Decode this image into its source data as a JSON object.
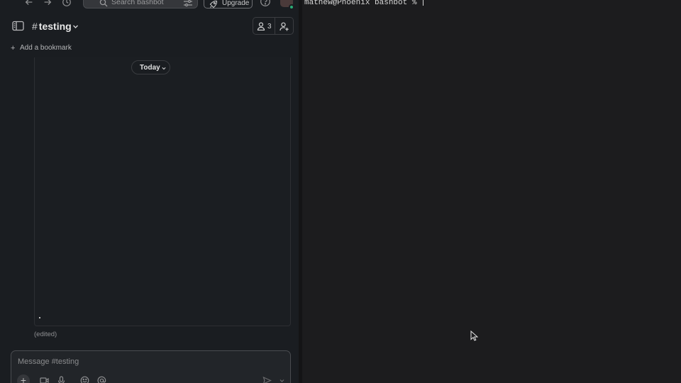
{
  "slack": {
    "search_placeholder": "Search bashbot",
    "upgrade_label": "Upgrade",
    "channel_hash": "#",
    "channel_name": "testing",
    "member_count": "3",
    "add_bookmark_label": "Add a bookmark",
    "date_divider_label": "Today",
    "edited_label": "(edited)",
    "composer_placeholder": "Message #testing",
    "status_color": "#2bac76"
  },
  "terminal": {
    "prompt": "mathew@Phoenix bashbot % "
  }
}
